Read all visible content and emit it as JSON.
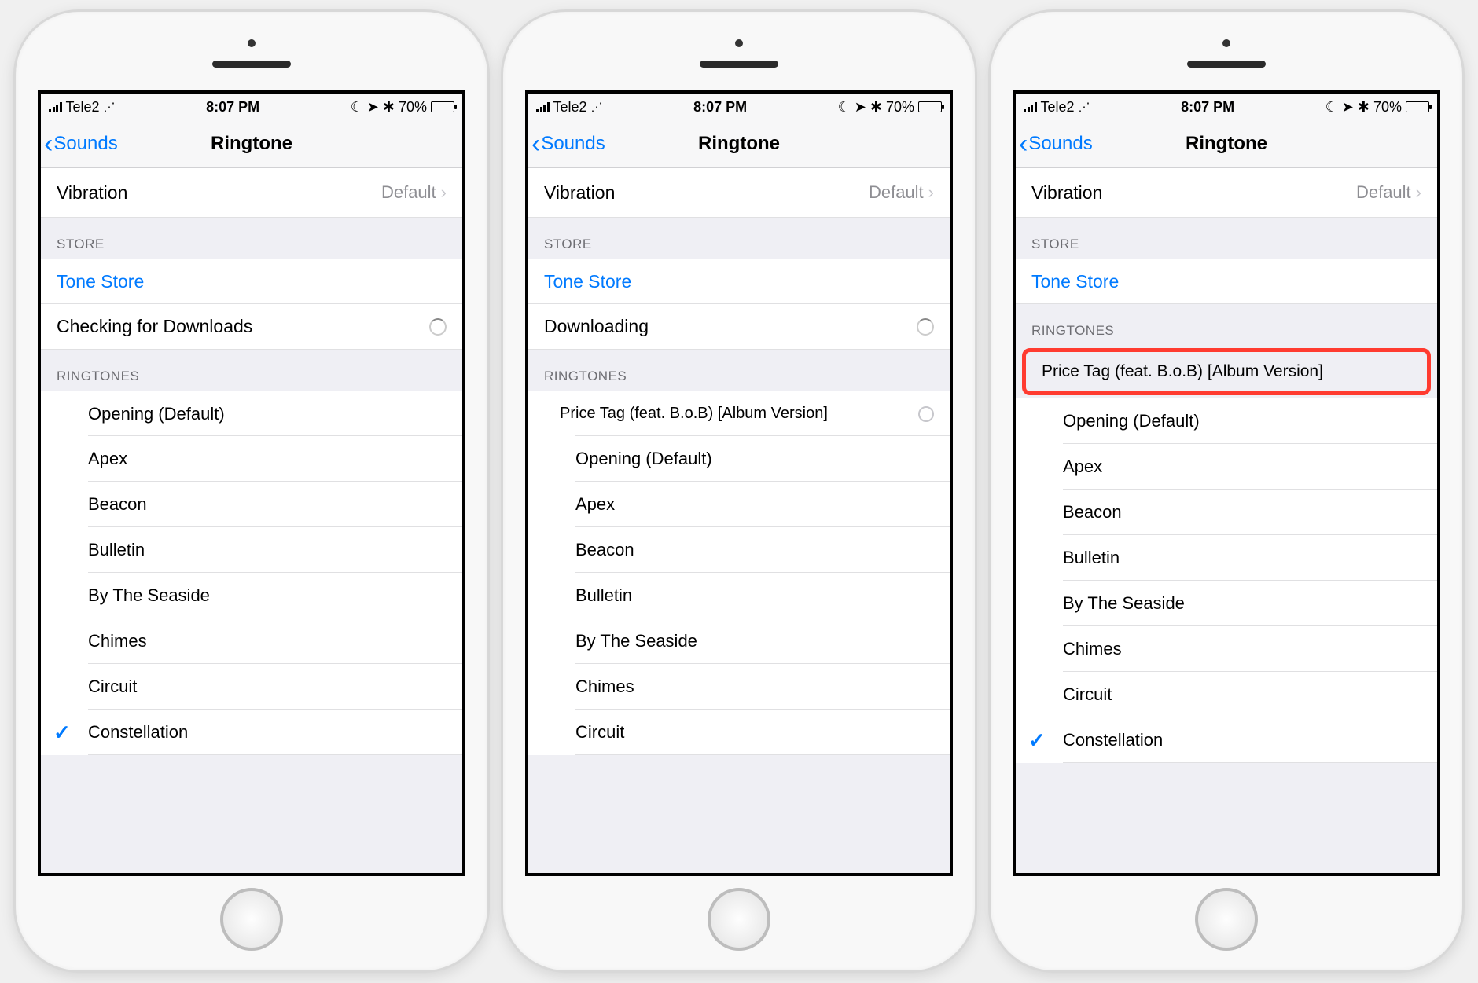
{
  "status": {
    "carrier": "Tele2",
    "time": "8:07 PM",
    "battery_pct": "70%"
  },
  "nav": {
    "back_label": "Sounds",
    "title": "Ringtone"
  },
  "vibration": {
    "label": "Vibration",
    "value": "Default"
  },
  "headers": {
    "store": "STORE",
    "ringtones": "RINGTONES"
  },
  "store": {
    "tone_store": "Tone Store"
  },
  "phone1_download_status": "Checking for Downloads",
  "phone2_download_status": "Downloading",
  "custom_tone": "Price Tag (feat. B.o.B) [Album Version]",
  "ringtones": {
    "r0": "Opening (Default)",
    "r1": "Apex",
    "r2": "Beacon",
    "r3": "Bulletin",
    "r4": "By The Seaside",
    "r5": "Chimes",
    "r6": "Circuit",
    "r7": "Constellation"
  }
}
